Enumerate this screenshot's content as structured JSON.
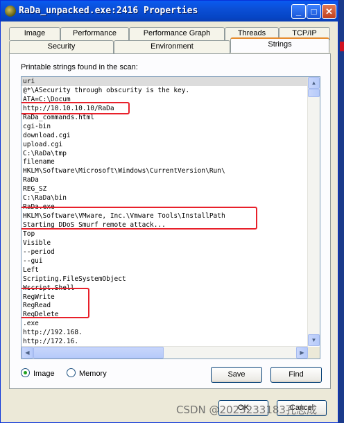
{
  "window": {
    "title": "RaDa_unpacked.exe:2416 Properties",
    "controls": {
      "minimize": "_",
      "maximize": "□",
      "close": "✕"
    }
  },
  "tabs": {
    "row1": [
      "Image",
      "Performance",
      "Performance Graph",
      "Threads",
      "TCP/IP"
    ],
    "row2": [
      "Security",
      "Environment",
      "Strings"
    ],
    "active": "Strings"
  },
  "panel": {
    "label": "Printable strings found in the scan:",
    "strings": [
      "uri",
      "@*\\ASecurity through obscurity is the key.",
      "ATA=C:\\Docum",
      "http://10.10.10.10/RaDa",
      "RaDa_commands.html",
      "cgi-bin",
      "download.cgi",
      "upload.cgi",
      "C:\\RaDa\\tmp",
      "filename",
      "HKLM\\Software\\Microsoft\\Windows\\CurrentVersion\\Run\\",
      "RaDa",
      "REG_SZ",
      "C:\\RaDa\\bin",
      "RaDa.exe",
      "HKLM\\Software\\VMware, Inc.\\Vmware Tools\\InstallPath",
      "Starting DDoS Smurf remote attack...",
      "Top",
      "Visible",
      "--period",
      "--gui",
      "Left",
      "Scripting.FileSystemObject",
      "Wscript.Shell",
      "RegWrite",
      "RegRead",
      "RegDelete",
      ".exe",
      "http://192.168.",
      "http://172.16."
    ],
    "selected_index": 0
  },
  "scan": {
    "options": [
      "Image",
      "Memory"
    ],
    "selected": "Image"
  },
  "buttons": {
    "save": "Save",
    "find": "Find",
    "ok": "OK",
    "cancel": "Cancel"
  },
  "watermark": "CSDN @2023233183孔志成",
  "colors": {
    "titlebar": "#0b4fd6",
    "highlight_box": "#e8202a",
    "tab_accent": "#e68b2c"
  }
}
